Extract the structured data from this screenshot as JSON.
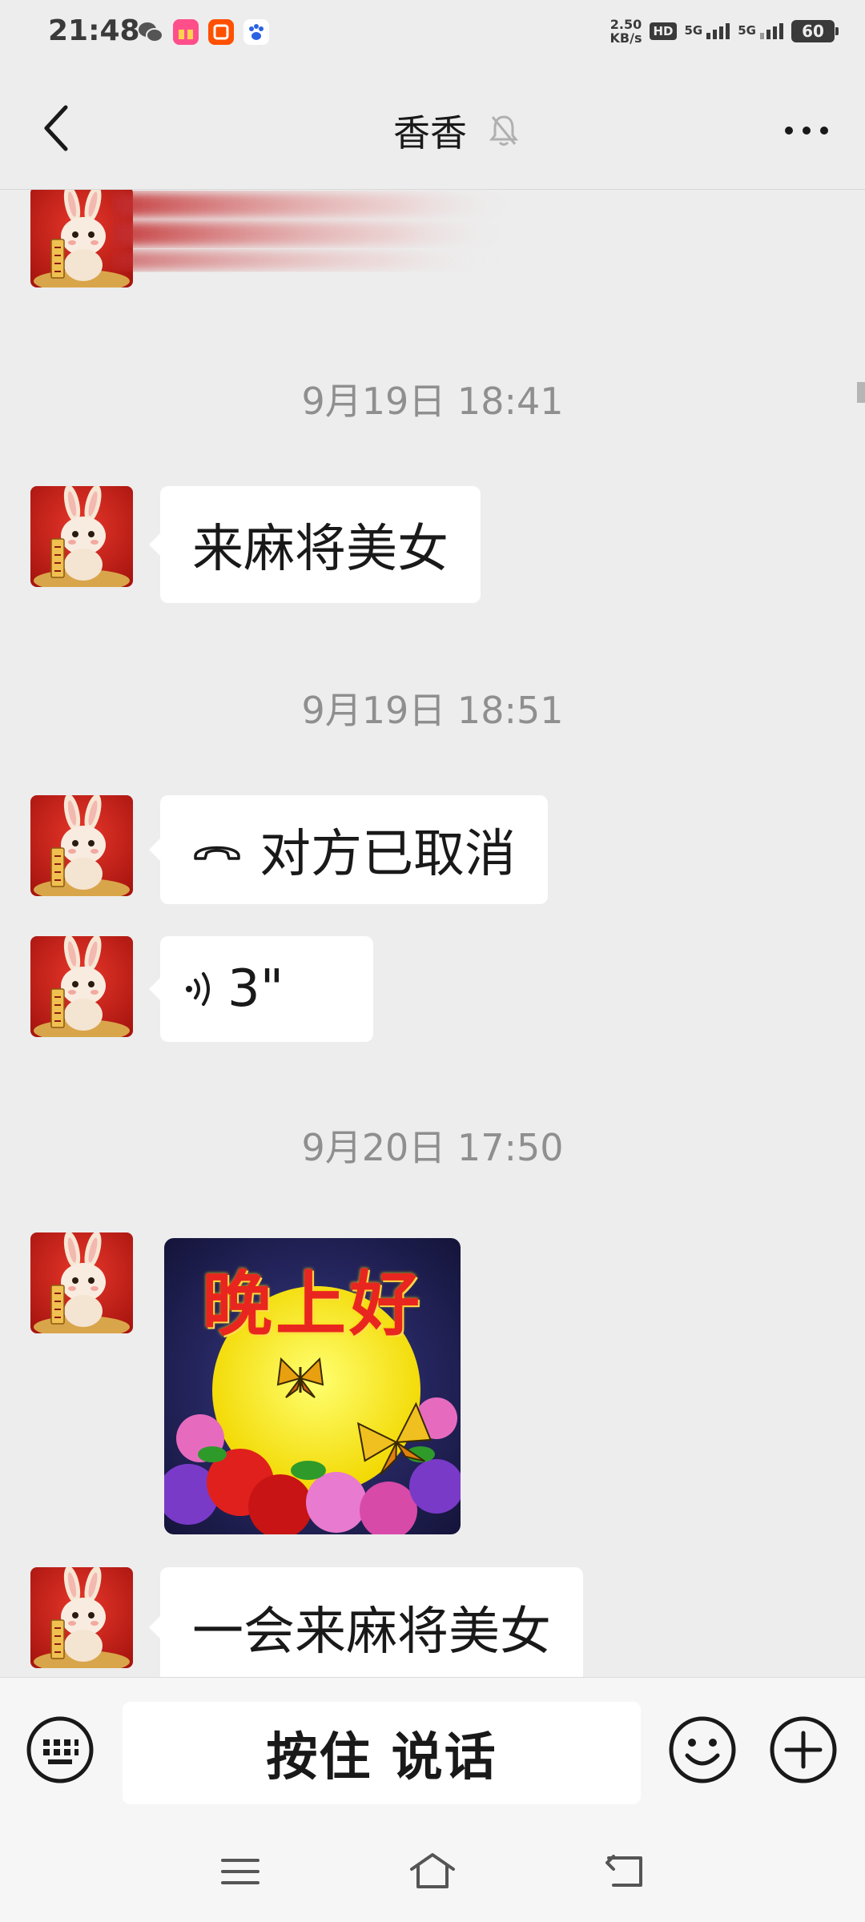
{
  "status_bar": {
    "time": "21:48",
    "net_speed_value": "2.50",
    "net_speed_unit": "KB/s",
    "hd_label": "HD",
    "signal_1_label": "5G",
    "signal_2_label": "5G",
    "battery_level": "60"
  },
  "header": {
    "contact_name": "香香",
    "muted": true
  },
  "messages": [
    {
      "type": "timestamp",
      "text": "9月19日 18:41"
    },
    {
      "type": "text",
      "text": "来麻将美女"
    },
    {
      "type": "timestamp",
      "text": "9月19日 18:51"
    },
    {
      "type": "call",
      "text": "对方已取消"
    },
    {
      "type": "voice",
      "duration": "3\""
    },
    {
      "type": "timestamp",
      "text": "9月20日 17:50"
    },
    {
      "type": "sticker",
      "text": "晚上好"
    },
    {
      "type": "text",
      "text": "一会来麻将美女"
    }
  ],
  "input_bar": {
    "hold_to_talk_label": "按住 说话"
  },
  "colors": {
    "background": "#ededed",
    "bubble": "#ffffff",
    "timestamp": "#8f8f8f",
    "avatar_bg": "#c8201c"
  }
}
